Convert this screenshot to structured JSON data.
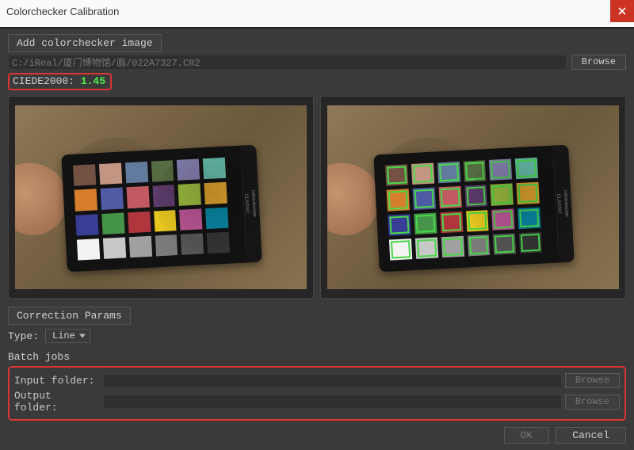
{
  "window": {
    "title": "Colorchecker Calibration"
  },
  "add_section": {
    "button_label": "Add colorchecker image",
    "path": "C:/iReal/厦门博物馆/画/022A7327.CR2",
    "browse_label": "Browse"
  },
  "ciede": {
    "label": "CIEDE2000:",
    "value": "1.45"
  },
  "color_swatches": [
    "#735244",
    "#c29682",
    "#627a9d",
    "#576c43",
    "#8580b1",
    "#67bdaa",
    "#d67e2c",
    "#505ba6",
    "#c15a63",
    "#5e3c6c",
    "#9dbc40",
    "#e0a32e",
    "#383d96",
    "#469449",
    "#af363c",
    "#e7c71f",
    "#bb5695",
    "#0885a1",
    "#f3f3f2",
    "#c8c8c8",
    "#a0a0a0",
    "#7a7a79",
    "#555555",
    "#343434"
  ],
  "params": {
    "tab_label": "Correction Params",
    "type_label": "Type:",
    "type_value": "Line"
  },
  "batch": {
    "section_label": "Batch jobs",
    "input_label": "Input folder:",
    "output_label": "Output folder:",
    "input_value": "",
    "output_value": "",
    "browse_label": "Browse"
  },
  "footer": {
    "ok": "OK",
    "cancel": "Cancel"
  }
}
